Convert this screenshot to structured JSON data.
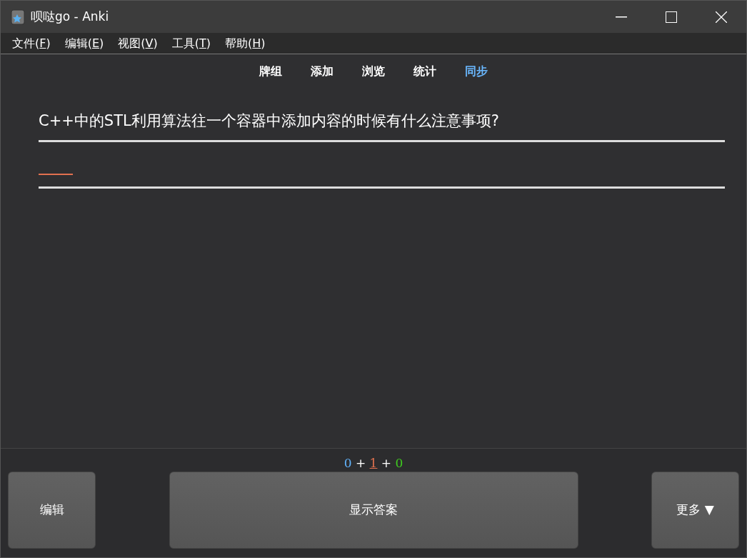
{
  "window": {
    "title": "呗哒go - Anki"
  },
  "menu": [
    {
      "text": "文件(",
      "accel": "F",
      "tail": ")"
    },
    {
      "text": "编辑(",
      "accel": "E",
      "tail": ")"
    },
    {
      "text": "视图(",
      "accel": "V",
      "tail": ")"
    },
    {
      "text": "工具(",
      "accel": "T",
      "tail": ")"
    },
    {
      "text": "帮助(",
      "accel": "H",
      "tail": ")"
    }
  ],
  "toolbar": [
    {
      "label": "牌组",
      "highlighted": false
    },
    {
      "label": "添加",
      "highlighted": false
    },
    {
      "label": "浏览",
      "highlighted": false
    },
    {
      "label": "统计",
      "highlighted": false
    },
    {
      "label": "同步",
      "highlighted": true
    }
  ],
  "card": {
    "question": "C++中的STL利用算法往一个容器中添加内容的时候有什么注意事项?"
  },
  "count_separator": "+",
  "counts": [
    {
      "value": "0",
      "color": "#62b5ff",
      "selected": false
    },
    {
      "value": "1",
      "color": "#e2714f",
      "selected": true
    },
    {
      "value": "0",
      "color": "#3fcc1f",
      "selected": false
    }
  ],
  "buttons": {
    "edit": "编辑",
    "show_answer": "显示答案",
    "more": "更多 ▼"
  }
}
